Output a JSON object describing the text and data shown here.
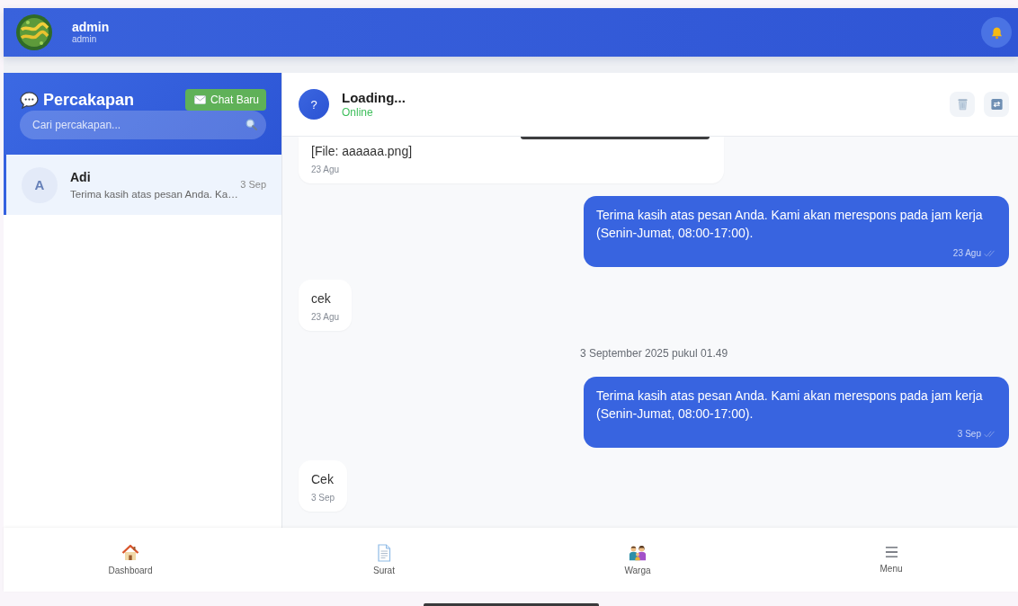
{
  "header": {
    "user_name": "admin",
    "user_role": "admin"
  },
  "sidebar": {
    "title": "Percakapan",
    "new_chat_button": "Chat Baru",
    "search": {
      "placeholder": "Cari percakapan..."
    },
    "conversations": [
      {
        "initial": "A",
        "name": "Adi",
        "preview": "Terima kasih atas pesan Anda. Ka…",
        "time": "3 Sep",
        "selected": true
      }
    ]
  },
  "chat": {
    "contact": {
      "initial": "?",
      "name": "Loading...",
      "status": "Online"
    },
    "messages": [
      {
        "kind": "incoming",
        "has_image": true,
        "text": "[File: aaaaaa.png]",
        "time": "23 Agu"
      },
      {
        "kind": "outgoing",
        "text": "Terima kasih atas pesan Anda. Kami akan merespons pada jam kerja (Senin-Jumat, 08:00-17:00).",
        "time": "23 Agu"
      },
      {
        "kind": "incoming",
        "text": "cek",
        "time": "23 Agu"
      },
      {
        "kind": "date",
        "text": "3 September 2025 pukul 01.49"
      },
      {
        "kind": "outgoing",
        "text": "Terima kasih atas pesan Anda. Kami akan merespons pada jam kerja (Senin-Jumat, 08:00-17:00).",
        "time": "3 Sep"
      },
      {
        "kind": "incoming",
        "text": "Cek",
        "time": "3 Sep"
      }
    ]
  },
  "bottom_nav": [
    {
      "label": "Dashboard"
    },
    {
      "label": "Surat"
    },
    {
      "label": "Warga"
    },
    {
      "label": "Menu"
    }
  ]
}
